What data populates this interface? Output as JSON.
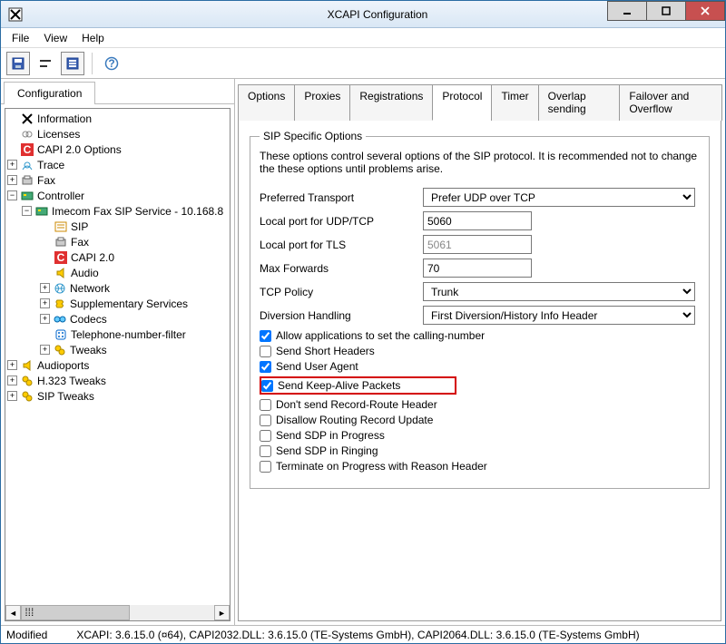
{
  "window": {
    "title": "XCAPI Configuration"
  },
  "menu": {
    "file": "File",
    "view": "View",
    "help": "Help"
  },
  "leftTab": "Configuration",
  "tree": {
    "information": "Information",
    "licenses": "Licenses",
    "capi20opts": "CAPI 2.0 Options",
    "trace": "Trace",
    "fax": "Fax",
    "controller": "Controller",
    "service": "Imecom Fax SIP Service - 10.168.8",
    "sip": "SIP",
    "fax2": "Fax",
    "capi20": "CAPI 2.0",
    "audio": "Audio",
    "network": "Network",
    "supplementary": "Supplementary Services",
    "codecs": "Codecs",
    "tnf": "Telephone-number-filter",
    "tweaks": "Tweaks",
    "audioports": "Audioports",
    "h323": "H.323 Tweaks",
    "siptweaks": "SIP Tweaks"
  },
  "tabs": {
    "options": "Options",
    "proxies": "Proxies",
    "registrations": "Registrations",
    "protocol": "Protocol",
    "timer": "Timer",
    "overlap": "Overlap sending",
    "failover": "Failover and Overflow"
  },
  "panel": {
    "legend": "SIP Specific Options",
    "desc": "These options control several options of the SIP protocol. It is recommended not to change the these options until problems arise.",
    "preferredTransportLabel": "Preferred Transport",
    "preferredTransportValue": "Prefer UDP over TCP",
    "localPortUdpLabel": "Local port for UDP/TCP",
    "localPortUdpValue": "5060",
    "localPortTlsLabel": "Local port for TLS",
    "localPortTlsValue": "5061",
    "maxForwardsLabel": "Max Forwards",
    "maxForwardsValue": "70",
    "tcpPolicyLabel": "TCP Policy",
    "tcpPolicyValue": "Trunk",
    "diversionLabel": "Diversion Handling",
    "diversionValue": "First Diversion/History Info Header",
    "chkAllow": "Allow applications to set the calling-number",
    "chkShort": "Send Short Headers",
    "chkUA": "Send User Agent",
    "chkKeepAlive": "Send Keep-Alive Packets",
    "chkRecordRoute": "Don't send Record-Route Header",
    "chkDisallow": "Disallow Routing Record Update",
    "chkSdpProgress": "Send SDP in Progress",
    "chkSdpRinging": "Send SDP in Ringing",
    "chkTerminate": "Terminate on Progress with Reason Header"
  },
  "status": {
    "modified": "Modified",
    "version": "XCAPI: 3.6.15.0 (¤64), CAPI2032.DLL: 3.6.15.0 (TE-Systems GmbH), CAPI2064.DLL: 3.6.15.0 (TE-Systems GmbH)"
  }
}
